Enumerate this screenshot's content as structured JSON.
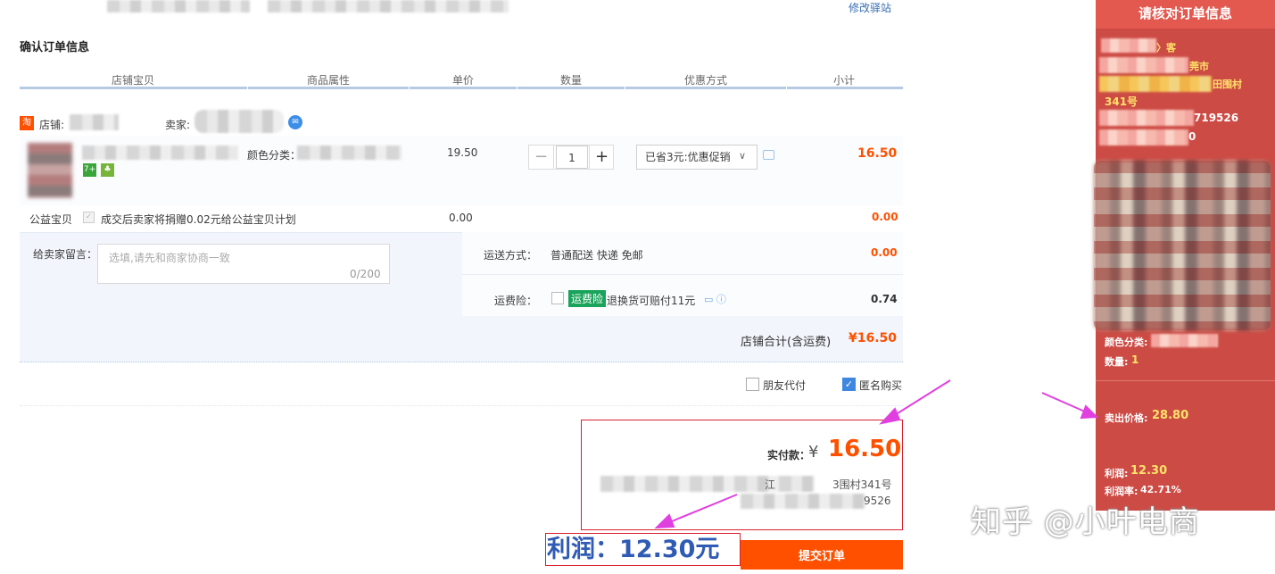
{
  "top": {
    "modify_link": "修改驿站"
  },
  "section_title": "确认订单信息",
  "table_headers": [
    "店铺宝贝",
    "商品属性",
    "单价",
    "数量",
    "优惠方式",
    "小计"
  ],
  "shop": {
    "icon_text": "淘",
    "shop_label": "店铺:",
    "seller_label": "卖家:"
  },
  "item": {
    "color_label": "颜色分类：",
    "unit_price": "19.50",
    "quantity": "1",
    "qty_minus": "−",
    "qty_plus": "+",
    "promotion": "已省3元:优惠促销",
    "subtotal": "16.50",
    "badge_1": "7+",
    "badge_2": "♣"
  },
  "charity": {
    "label": "公益宝贝",
    "text": "成交后卖家将捐赠0.02元给公益宝贝计划",
    "price": "0.00",
    "subtotal": "0.00"
  },
  "memo": {
    "label": "给卖家留言：",
    "placeholder": "选填,请先和商家协商一致",
    "counter": "0/200"
  },
  "delivery": {
    "label": "运送方式：",
    "method": "普通配送 快递 免邮",
    "fee": "0.00"
  },
  "insurance": {
    "label": "运费险：",
    "tag": "运费险",
    "text": "退换货可赔付11元",
    "price": "0.74"
  },
  "shop_total": {
    "label": "店铺合计(含运费)",
    "value": "¥16.50"
  },
  "options": {
    "friend_pay": "朋友代付",
    "anonymous": "匿名购买"
  },
  "payment": {
    "label": "实付款：",
    "yen": "¥",
    "amount": "16.50",
    "address_fragment_1": "江",
    "address_fragment_2": "3围村341号",
    "phone_fragment": "9526"
  },
  "profit_annotation": "利润：12.30元",
  "submit_button": "提交订单",
  "right_panel": {
    "header": "请核对订单信息",
    "line1": "〉客",
    "line2": "莞市",
    "line3": "田围村",
    "line4": "341号",
    "line5": "719526",
    "line6": "0",
    "color_label": "颜色分类:",
    "qty_label": "数量:",
    "qty_value": "1",
    "sell_label": "卖出价格:",
    "sell_value": "28.80",
    "profit_label": "利润:",
    "profit_value": "12.30",
    "rate_label": "利润率:",
    "rate_value": "42.71%"
  },
  "watermark": "知乎 @小叶电商",
  "colors": {
    "accent_orange": "#ff5000",
    "annotation_red": "#d82030",
    "annotation_blue": "#2f5bb5",
    "arrow_magenta": "#e040e0",
    "panel_red": "#cd4b45",
    "panel_yellow": "#ffe36a"
  }
}
